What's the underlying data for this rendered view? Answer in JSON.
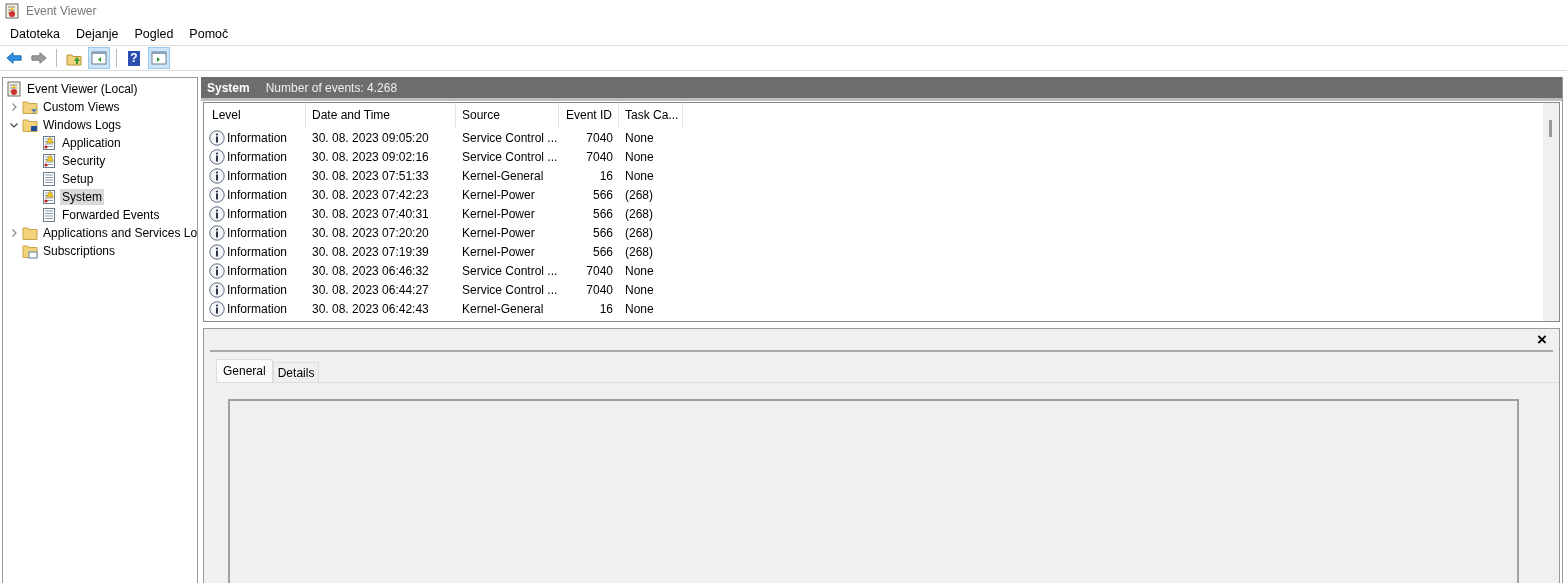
{
  "window": {
    "title": "Event Viewer"
  },
  "menu": [
    "Datoteka",
    "Dejanje",
    "Pogled",
    "Pomoč"
  ],
  "toolbar": [
    {
      "kind": "back",
      "pressed": false
    },
    {
      "kind": "forward",
      "pressed": false
    },
    {
      "kind": "separator"
    },
    {
      "kind": "up",
      "pressed": false
    },
    {
      "kind": "tree-pane",
      "pressed": true
    },
    {
      "kind": "separator"
    },
    {
      "kind": "help",
      "label": "?",
      "pressed": false
    },
    {
      "kind": "action-pane",
      "pressed": true
    }
  ],
  "tree": [
    {
      "label": "Event Viewer (Local)",
      "kind": "root",
      "selected": false,
      "children": [
        {
          "label": "Custom Views",
          "kind": "filter-folder",
          "expanded": false,
          "selected": false
        },
        {
          "label": "Windows Logs",
          "kind": "computer-folder",
          "expanded": true,
          "selected": false,
          "children": [
            {
              "label": "Application",
              "kind": "alert-log",
              "selected": false
            },
            {
              "label": "Security",
              "kind": "alert-log",
              "selected": false
            },
            {
              "label": "Setup",
              "kind": "log",
              "selected": false
            },
            {
              "label": "System",
              "kind": "alert-log",
              "selected": true
            },
            {
              "label": "Forwarded Events",
              "kind": "log",
              "selected": false
            }
          ]
        },
        {
          "label": "Applications and Services Lo",
          "kind": "folder",
          "expanded": false,
          "selected": false
        },
        {
          "label": "Subscriptions",
          "kind": "subscription-folder",
          "selected": false
        }
      ]
    }
  ],
  "header": {
    "title": "System",
    "count": "Number of events: 4.268"
  },
  "table": {
    "columns": [
      "Level",
      "Date and Time",
      "Source",
      "Event ID",
      "Task Ca..."
    ],
    "rows": [
      [
        "Information",
        "30. 08. 2023 09:05:20",
        "Service Control ...",
        "7040",
        "None"
      ],
      [
        "Information",
        "30. 08. 2023 09:02:16",
        "Service Control ...",
        "7040",
        "None"
      ],
      [
        "Information",
        "30. 08. 2023 07:51:33",
        "Kernel-General",
        "16",
        "None"
      ],
      [
        "Information",
        "30. 08. 2023 07:42:23",
        "Kernel-Power",
        "566",
        "(268)"
      ],
      [
        "Information",
        "30. 08. 2023 07:40:31",
        "Kernel-Power",
        "566",
        "(268)"
      ],
      [
        "Information",
        "30. 08. 2023 07:20:20",
        "Kernel-Power",
        "566",
        "(268)"
      ],
      [
        "Information",
        "30. 08. 2023 07:19:39",
        "Kernel-Power",
        "566",
        "(268)"
      ],
      [
        "Information",
        "30. 08. 2023 06:46:32",
        "Service Control ...",
        "7040",
        "None"
      ],
      [
        "Information",
        "30. 08. 2023 06:44:27",
        "Service Control ...",
        "7040",
        "None"
      ],
      [
        "Information",
        "30. 08. 2023 06:42:43",
        "Kernel-General",
        "16",
        "None"
      ]
    ]
  },
  "details": {
    "close": "×",
    "tabs": [
      {
        "label": "General",
        "selected": true
      },
      {
        "label": "Details",
        "selected": false
      }
    ]
  }
}
